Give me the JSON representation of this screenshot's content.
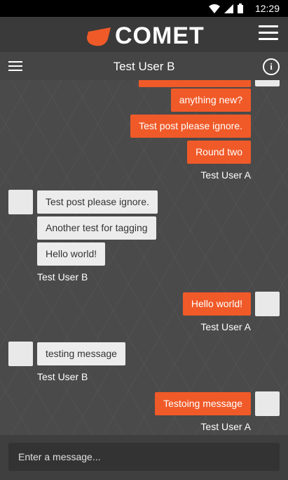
{
  "status": {
    "time": "12:29"
  },
  "app": {
    "logo_text": "COMET",
    "accent": "#f05a28"
  },
  "conversation": {
    "title": "Test User B"
  },
  "messages": {
    "m1": "anything new?",
    "m2": "Test post please ignore.",
    "m3": "Round two",
    "m3_sender": "Test User A",
    "m4": "Test post please ignore.",
    "m5": "Another test for tagging",
    "m6": "Hello world!",
    "m6_sender": "Test User B",
    "m7": "Hello world!",
    "m7_sender": "Test User A",
    "m8": "testing message",
    "m8_sender": "Test User B",
    "m9": "Testoing message",
    "m9_sender": "Test User A"
  },
  "composer": {
    "placeholder": "Enter a message..."
  }
}
